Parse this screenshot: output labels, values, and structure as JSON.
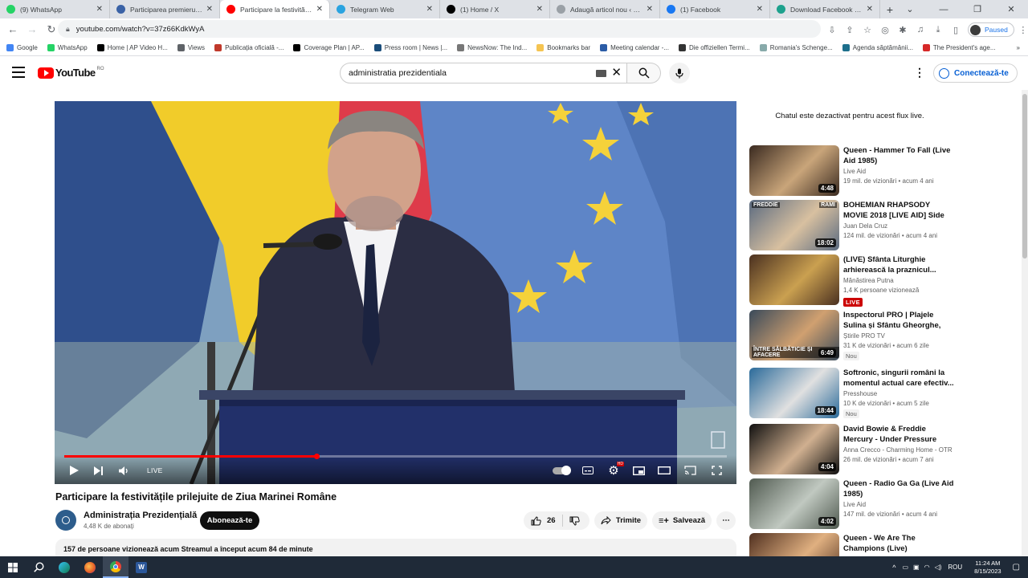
{
  "browser": {
    "tabs": [
      {
        "title": "(9) WhatsApp",
        "color": "#25d366",
        "active": false
      },
      {
        "title": "Participarea premierului M",
        "color": "#3a62a6",
        "active": false
      },
      {
        "title": "Participare la festivitățile p",
        "color": "#ff0000",
        "active": true
      },
      {
        "title": "Telegram Web",
        "color": "#2aa3e0",
        "active": false
      },
      {
        "title": "(1) Home / X",
        "color": "#000000",
        "active": false
      },
      {
        "title": "Adaugă articol nou ‹ Gând",
        "color": "#9aa0a6",
        "active": false
      },
      {
        "title": "(1) Facebook",
        "color": "#1877f2",
        "active": false
      },
      {
        "title": "Download Facebook Video",
        "color": "#1da18d",
        "active": false
      }
    ],
    "url": "youtube.com/watch?v=37z66KdkWyA",
    "profile_status": "Paused",
    "bookmarks": [
      {
        "label": "Google",
        "color": "#4285f4"
      },
      {
        "label": "WhatsApp",
        "color": "#25d366"
      },
      {
        "label": "Home | AP Video H...",
        "color": "#000000"
      },
      {
        "label": "Views",
        "color": "#5f6368"
      },
      {
        "label": "Publicația oficială -...",
        "color": "#c0392b"
      },
      {
        "label": "Coverage Plan | AP...",
        "color": "#000000"
      },
      {
        "label": "Press room | News |...",
        "color": "#1a4d7a"
      },
      {
        "label": "NewsNow: The Ind...",
        "color": "#777777"
      },
      {
        "label": "Bookmarks bar",
        "color": "#f5c451"
      },
      {
        "label": "Meeting calendar -...",
        "color": "#2b5ca6"
      },
      {
        "label": "Die offiziellen Termi...",
        "color": "#333333"
      },
      {
        "label": "Romania's Schenge...",
        "color": "#8aa"
      },
      {
        "label": "Agenda săptămânii...",
        "color": "#1d6f8c"
      },
      {
        "label": "The President's age...",
        "color": "#d62828"
      }
    ]
  },
  "youtube": {
    "logo_text": "YouTube",
    "country_code": "RO",
    "search_query": "administratia prezidentiala",
    "sign_in_label": "Conectează-te"
  },
  "player": {
    "live_label": "LIVE",
    "progress_fraction": 0.38,
    "hd_badge": "HD"
  },
  "video": {
    "title": "Participare la festivitățile prilejuite de Ziua Marinei Române",
    "channel_name": "Administrația Prezidențială",
    "subscribers": "4,48 K de abonați",
    "subscribe_label": "Abonează-te",
    "likes": "26",
    "share_label": "Trimite",
    "save_label": "Salvează",
    "description_summary": "157 de persoane vizionează acum  Streamul a început acum 84 de minute"
  },
  "sidebar": {
    "chat_disabled": "Chatul este dezactivat pentru acest flux live.",
    "recommendations": [
      {
        "title": "Queen - Hammer To Fall (Live Aid 1985)",
        "channel": "Live Aid",
        "meta": "19 mil. de vizionări  • acum 4 ani",
        "duration": "4:48",
        "badge": "",
        "colors": [
          "#3a2a20",
          "#c9a57a"
        ]
      },
      {
        "title": "BOHEMIAN RHAPSODY MOVIE 2018 [LIVE AID] Side by Side w...",
        "channel": "Juan Dela Cruz",
        "meta": "124 mil. de vizionări  • acum 4 ani",
        "duration": "18:02",
        "badge": "",
        "colors": [
          "#5a6a80",
          "#d8c0a0"
        ],
        "overlay": [
          "FREDDIE",
          "RAMI"
        ]
      },
      {
        "title": "(LIVE) Sfânta Liturghie arhierească la praznicul...",
        "channel": "Mănăstirea Putna",
        "meta": "1,4 K persoane vizionează",
        "duration": "",
        "badge": "LIVE",
        "colors": [
          "#4a3020",
          "#caa050"
        ]
      },
      {
        "title": "Inspectorul PRO | Plajele Sulina și Sfântu Gheorghe, între...",
        "channel": "Știrile PRO TV",
        "meta": "31 K de vizionări  • acum 6 zile",
        "duration": "6:49",
        "badge": "Nou",
        "colors": [
          "#3a4a5a",
          "#d0a070"
        ],
        "overlay": [
          "ÎNTRE SĂLBĂTICIE ȘI AFACERE"
        ]
      },
      {
        "title": "Softronic, singurii români la momentul actual care efectiv...",
        "channel": "Presshouse",
        "meta": "10 K de vizionări  • acum 5 zile",
        "duration": "18:44",
        "badge": "Nou",
        "colors": [
          "#2a6a9a",
          "#e0e0e0"
        ]
      },
      {
        "title": "David Bowie & Freddie Mercury - Under Pressure",
        "channel": "Anna Crecco - Charming Home - OTR",
        "meta": "26 mil. de vizionări  • acum 7 ani",
        "duration": "4:04",
        "badge": "",
        "colors": [
          "#101010",
          "#d0b090"
        ]
      },
      {
        "title": "Queen - Radio Ga Ga (Live Aid 1985)",
        "channel": "Live Aid",
        "meta": "147 mil. de vizionări  • acum 4 ani",
        "duration": "4:02",
        "badge": "",
        "colors": [
          "#505a50",
          "#c0c8c0"
        ]
      },
      {
        "title": "Queen - We Are The Champions (Live)",
        "channel": "",
        "meta": "",
        "duration": "",
        "badge": "",
        "colors": [
          "#503020",
          "#e0b080"
        ]
      }
    ]
  },
  "taskbar": {
    "time": "11:24 AM",
    "date": "8/15/2023",
    "language": "ROU"
  }
}
